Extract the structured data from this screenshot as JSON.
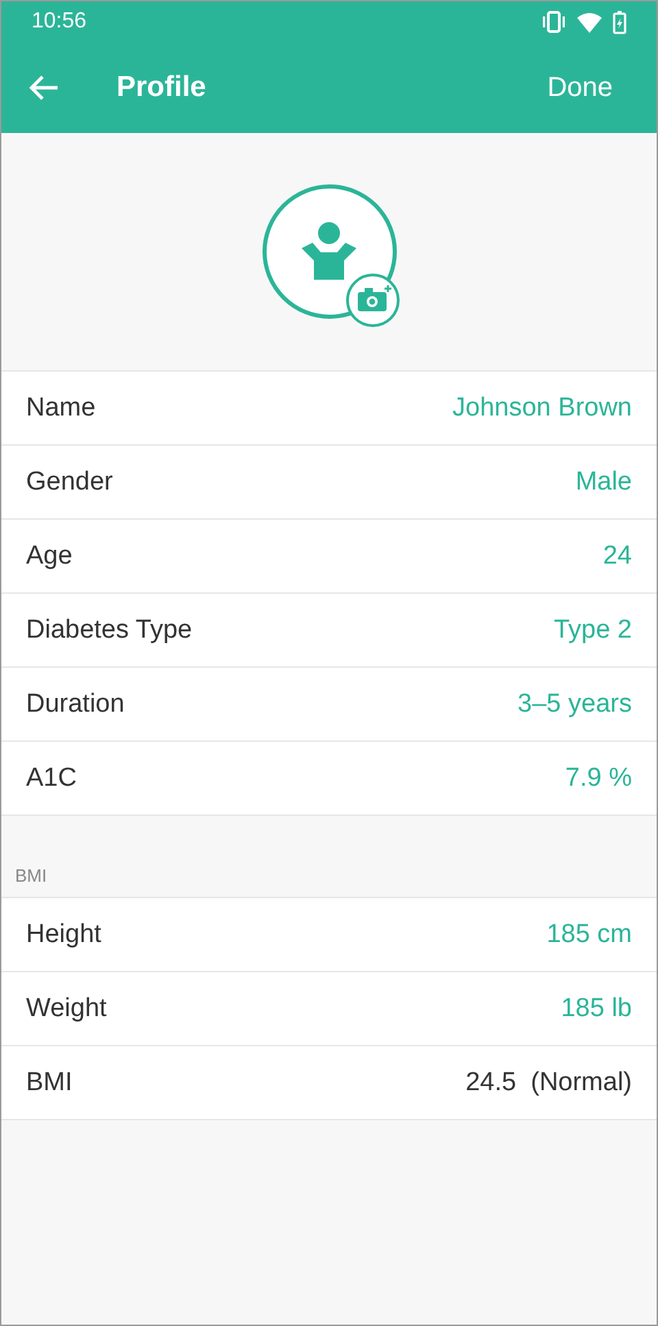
{
  "status_bar": {
    "time": "10:56"
  },
  "header": {
    "title": "Profile",
    "action": "Done"
  },
  "sections": [
    {
      "rows": [
        {
          "label": "Name",
          "value": "Johnson Brown",
          "editable": true
        },
        {
          "label": "Gender",
          "value": "Male",
          "editable": true
        },
        {
          "label": "Age",
          "value": "24",
          "editable": true
        },
        {
          "label": "Diabetes Type",
          "value": "Type 2",
          "editable": true
        },
        {
          "label": "Duration",
          "value": "3–5 years",
          "editable": true
        },
        {
          "label": "A1C",
          "value": "7.9 %",
          "editable": true
        }
      ]
    },
    {
      "title": "BMI",
      "rows": [
        {
          "label": "Height",
          "value": "185 cm",
          "editable": true
        },
        {
          "label": "Weight",
          "value": "185 lb",
          "editable": true
        },
        {
          "label": "BMI",
          "value": "24.5  (Normal)",
          "editable": false
        }
      ]
    }
  ]
}
